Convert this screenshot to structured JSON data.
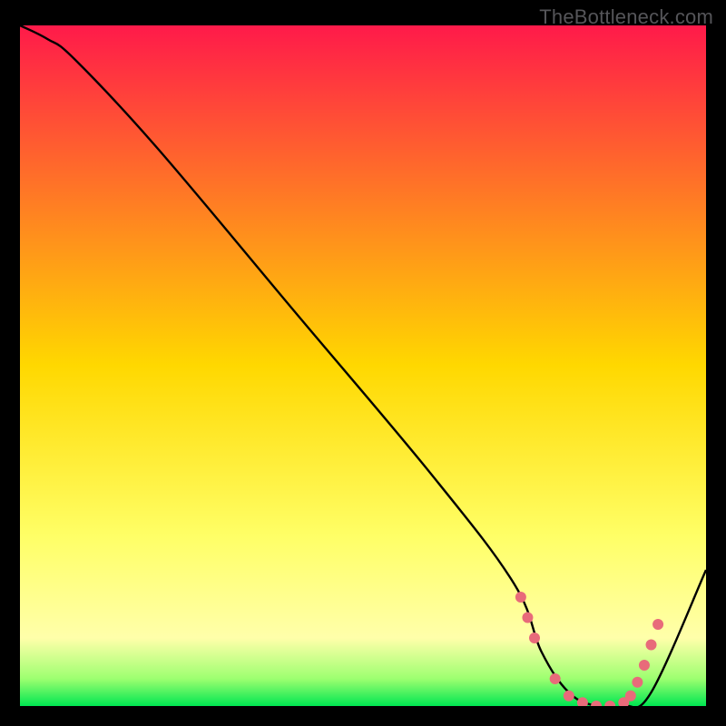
{
  "watermark": "TheBottleneck.com",
  "chart_data": {
    "type": "line",
    "title": "",
    "xlabel": "",
    "ylabel": "",
    "xlim": [
      0,
      100
    ],
    "ylim": [
      0,
      100
    ],
    "background_gradient_stops": [
      {
        "offset": 0,
        "color": "#ff1a4a"
      },
      {
        "offset": 50,
        "color": "#ffd800"
      },
      {
        "offset": 75,
        "color": "#ffff66"
      },
      {
        "offset": 90,
        "color": "#ffffaa"
      },
      {
        "offset": 96,
        "color": "#9dff70"
      },
      {
        "offset": 100,
        "color": "#00e652"
      }
    ],
    "series": [
      {
        "name": "curve",
        "x": [
          0,
          4,
          8,
          20,
          40,
          60,
          72,
          76,
          80,
          84,
          88,
          92,
          100
        ],
        "y": [
          100,
          98,
          95,
          82,
          58,
          34,
          18,
          8,
          2,
          0,
          0,
          2,
          20
        ]
      }
    ],
    "markers": {
      "name": "highlight-points",
      "x": [
        73,
        74,
        75,
        78,
        80,
        82,
        84,
        86,
        88,
        89,
        90,
        91,
        92,
        93
      ],
      "y": [
        16,
        13,
        10,
        4,
        1.5,
        0.5,
        0,
        0,
        0.5,
        1.5,
        3.5,
        6,
        9,
        12
      ],
      "color": "#e86b7a",
      "radius": 6
    }
  }
}
